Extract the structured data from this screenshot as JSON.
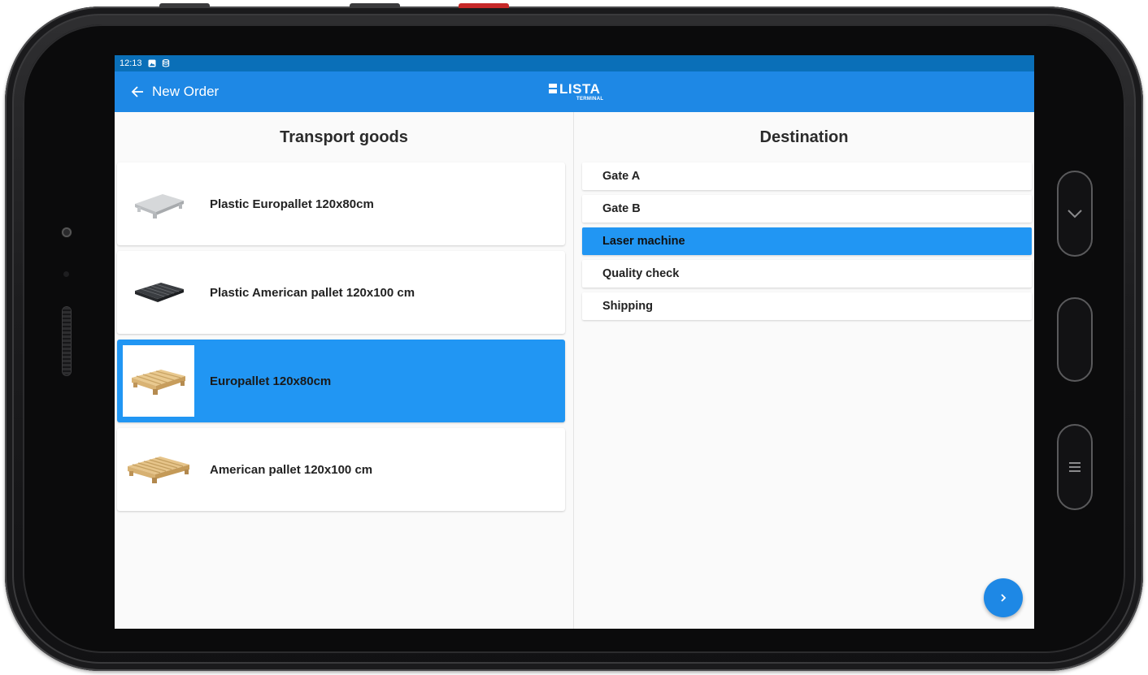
{
  "status_bar": {
    "time": "12:13",
    "icons": [
      "image-notification-icon",
      "storage-notification-icon"
    ]
  },
  "app_bar": {
    "back_icon": "arrow-left-icon",
    "title": "New Order",
    "logo_text": "LISTA",
    "logo_subtext": "TERMINAL"
  },
  "transport_goods": {
    "heading": "Transport goods",
    "items": [
      {
        "label": "Plastic Europallet 120x80cm",
        "icon": "plastic-europallet-image",
        "selected": false
      },
      {
        "label": "Plastic American pallet 120x100 cm",
        "icon": "plastic-american-pallet-image",
        "selected": false
      },
      {
        "label": "Europallet 120x80cm",
        "icon": "wooden-europallet-image",
        "selected": true
      },
      {
        "label": "American pallet 120x100 cm",
        "icon": "wooden-american-pallet-image",
        "selected": false
      }
    ]
  },
  "destination": {
    "heading": "Destination",
    "items": [
      {
        "label": "Gate A",
        "selected": false
      },
      {
        "label": "Gate B",
        "selected": false
      },
      {
        "label": "Laser machine",
        "selected": true
      },
      {
        "label": "Quality check",
        "selected": false
      },
      {
        "label": "Shipping",
        "selected": false
      }
    ]
  },
  "next_button": {
    "icon": "chevron-right-icon"
  },
  "colors": {
    "primary": "#1e88e5",
    "status_bar": "#0a6fb8",
    "selection": "#2196f3",
    "background": "#fafafa"
  }
}
